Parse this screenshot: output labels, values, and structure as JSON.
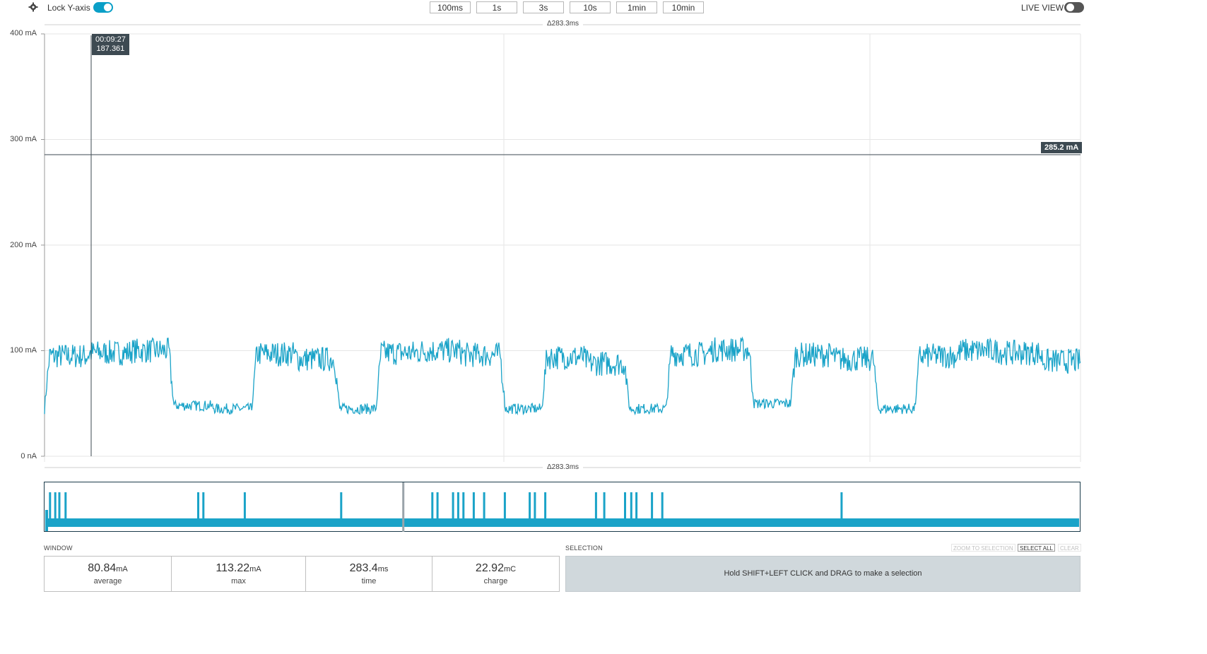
{
  "toolbar": {
    "lock_y_axis_label": "Lock Y-axis",
    "lock_y_axis_on": true,
    "zoom_buttons": [
      "100ms",
      "1s",
      "3s",
      "10s",
      "1min",
      "10min"
    ],
    "live_view_label": "LIVE VIEW",
    "live_view_on": false
  },
  "chart": {
    "delta_top": "Δ283.3ms",
    "delta_bottom": "Δ283.3ms",
    "cursor_time": "00:09:27",
    "cursor_value": "187.361",
    "hline_label": "285.2 mA",
    "y_ticks": [
      "400 mA",
      "300 mA",
      "200 mA",
      "100 mA",
      "0 nA"
    ]
  },
  "chart_data": {
    "type": "line",
    "ylim": [
      0,
      400
    ],
    "y_unit": "mA",
    "y_ticks": [
      0,
      100,
      200,
      300,
      400
    ],
    "series": [
      {
        "color": "#1aa3c8",
        "x": [
          0,
          4,
          8,
          12,
          16,
          20,
          24,
          28,
          32,
          36,
          40,
          44,
          48,
          52,
          56,
          60,
          64,
          68,
          72,
          76,
          80,
          84,
          88,
          92,
          96,
          100
        ],
        "values": [
          45,
          95,
          98,
          100,
          48,
          45,
          97,
          92,
          45,
          98,
          100,
          96,
          45,
          94,
          88,
          45,
          97,
          101,
          50,
          96,
          92,
          45,
          95,
          100,
          98,
          90
        ]
      }
    ],
    "horizontal_marker": 285.2,
    "overview": {
      "type": "line",
      "baseline_band": "noise",
      "spikes_relative": [
        0.5,
        1.0,
        1.4,
        2.0,
        14.8,
        15.3,
        19.3,
        28.6,
        37.4,
        37.9,
        39.4,
        39.9,
        40.4,
        41.4,
        42.4,
        44.4,
        46.8,
        47.3,
        48.3,
        53.2,
        54.0,
        56.0,
        56.6,
        57.1,
        58.6,
        59.6,
        76.9
      ]
    },
    "window_start_relative": 34.6
  },
  "window": {
    "title": "WINDOW",
    "stats": [
      {
        "value": "80.84",
        "unit": "mA",
        "label": "average"
      },
      {
        "value": "113.22",
        "unit": "mA",
        "label": "max"
      },
      {
        "value": "283.4",
        "unit": "ms",
        "label": "time"
      },
      {
        "value": "22.92",
        "unit": "mC",
        "label": "charge"
      }
    ]
  },
  "selection": {
    "title": "SELECTION",
    "zoom_to_selection": "ZOOM TO SELECTION",
    "select_all": "SELECT ALL",
    "clear": "CLEAR",
    "hint": "Hold SHIFT+LEFT CLICK and DRAG to make a selection"
  },
  "colors": {
    "accent": "#0a9fc7",
    "trace": "#1aa3c8",
    "cursor_bg": "#3d4a52",
    "selection_bg": "#d0d8dc"
  }
}
